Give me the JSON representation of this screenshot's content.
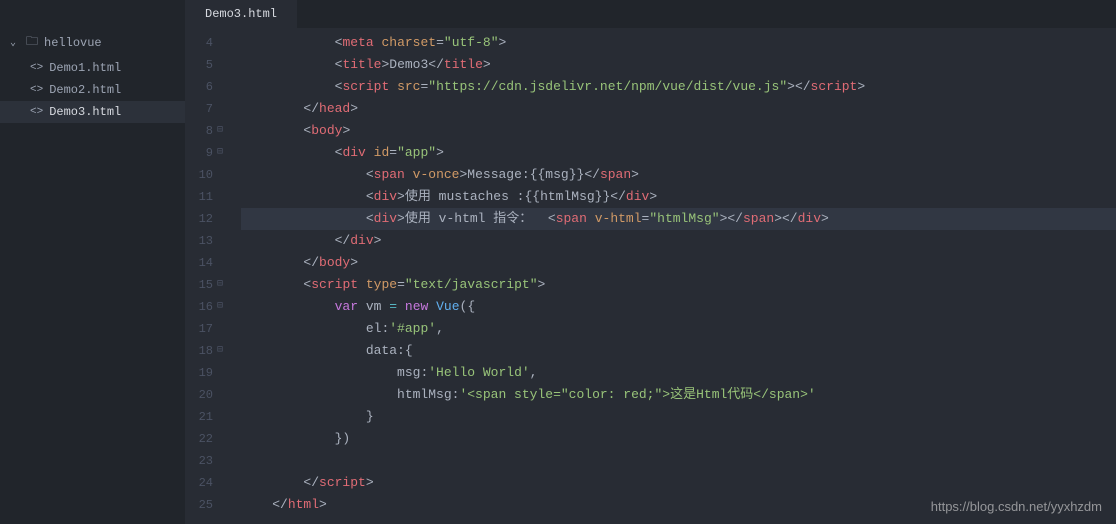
{
  "sidebar": {
    "folder": "hellovue",
    "files": [
      {
        "name": "Demo1.html",
        "active": false
      },
      {
        "name": "Demo2.html",
        "active": false
      },
      {
        "name": "Demo3.html",
        "active": true
      }
    ]
  },
  "tab": {
    "label": "Demo3.html"
  },
  "gutter": [
    {
      "num": "4",
      "fold": ""
    },
    {
      "num": "5",
      "fold": ""
    },
    {
      "num": "6",
      "fold": ""
    },
    {
      "num": "7",
      "fold": ""
    },
    {
      "num": "8",
      "fold": "⊟"
    },
    {
      "num": "9",
      "fold": "⊟"
    },
    {
      "num": "10",
      "fold": ""
    },
    {
      "num": "11",
      "fold": ""
    },
    {
      "num": "12",
      "fold": ""
    },
    {
      "num": "13",
      "fold": ""
    },
    {
      "num": "14",
      "fold": ""
    },
    {
      "num": "15",
      "fold": "⊟"
    },
    {
      "num": "16",
      "fold": "⊟"
    },
    {
      "num": "17",
      "fold": ""
    },
    {
      "num": "18",
      "fold": "⊟"
    },
    {
      "num": "19",
      "fold": ""
    },
    {
      "num": "20",
      "fold": ""
    },
    {
      "num": "21",
      "fold": ""
    },
    {
      "num": "22",
      "fold": ""
    },
    {
      "num": "23",
      "fold": ""
    },
    {
      "num": "24",
      "fold": ""
    },
    {
      "num": "25",
      "fold": ""
    }
  ],
  "code": {
    "l4": {
      "indent": "            ",
      "t1": "meta",
      "a1": "charset",
      "v1": "\"utf-8\""
    },
    "l5": {
      "indent": "            ",
      "t1": "title",
      "txt": "Demo3"
    },
    "l6": {
      "indent": "            ",
      "t1": "script",
      "a1": "src",
      "v1": "\"https://cdn.jsdelivr.net/npm/vue/dist/vue.js\""
    },
    "l7": {
      "indent": "        ",
      "t1": "head"
    },
    "l8": {
      "indent": "        ",
      "t1": "body"
    },
    "l9": {
      "indent": "            ",
      "t1": "div",
      "a1": "id",
      "v1": "\"app\""
    },
    "l10": {
      "indent": "                ",
      "t1": "span",
      "a1": "v-once",
      "txt": "Message:{{msg}}"
    },
    "l11": {
      "indent": "                ",
      "t1": "div",
      "txt": "使用 mustaches :{{htmlMsg}}"
    },
    "l12": {
      "indent": "                ",
      "t1": "div",
      "txt1": "使用 v-html 指令：  ",
      "t2": "span",
      "a2": "v-html",
      "v2": "\"htmlMsg\""
    },
    "l13": {
      "indent": "            ",
      "t1": "div"
    },
    "l14": {
      "indent": "        ",
      "t1": "body"
    },
    "l15": {
      "indent": "        ",
      "t1": "script",
      "a1": "type",
      "v1": "\"text/javascript\""
    },
    "l16": {
      "indent": "            ",
      "k1": "var",
      "id": "vm",
      "op": "=",
      "k2": "new",
      "fn": "Vue",
      "p": "({"
    },
    "l17": {
      "indent": "                ",
      "key": "el",
      "val": "'#app'",
      "c": ","
    },
    "l18": {
      "indent": "                ",
      "key": "data",
      "p": ":{"
    },
    "l19": {
      "indent": "                    ",
      "key": "msg",
      "val": "'Hello World'",
      "c": ","
    },
    "l20": {
      "indent": "                    ",
      "key": "htmlMsg",
      "val": "'<span style=\"color: red;\">这是Html代码</span>'"
    },
    "l21": {
      "indent": "                ",
      "p": "}"
    },
    "l22": {
      "indent": "            ",
      "p": "})"
    },
    "l23": {
      "indent": ""
    },
    "l24": {
      "indent": "        ",
      "t1": "script"
    },
    "l25": {
      "indent": "    ",
      "t1": "html"
    }
  },
  "watermark": "https://blog.csdn.net/yyxhzdm"
}
